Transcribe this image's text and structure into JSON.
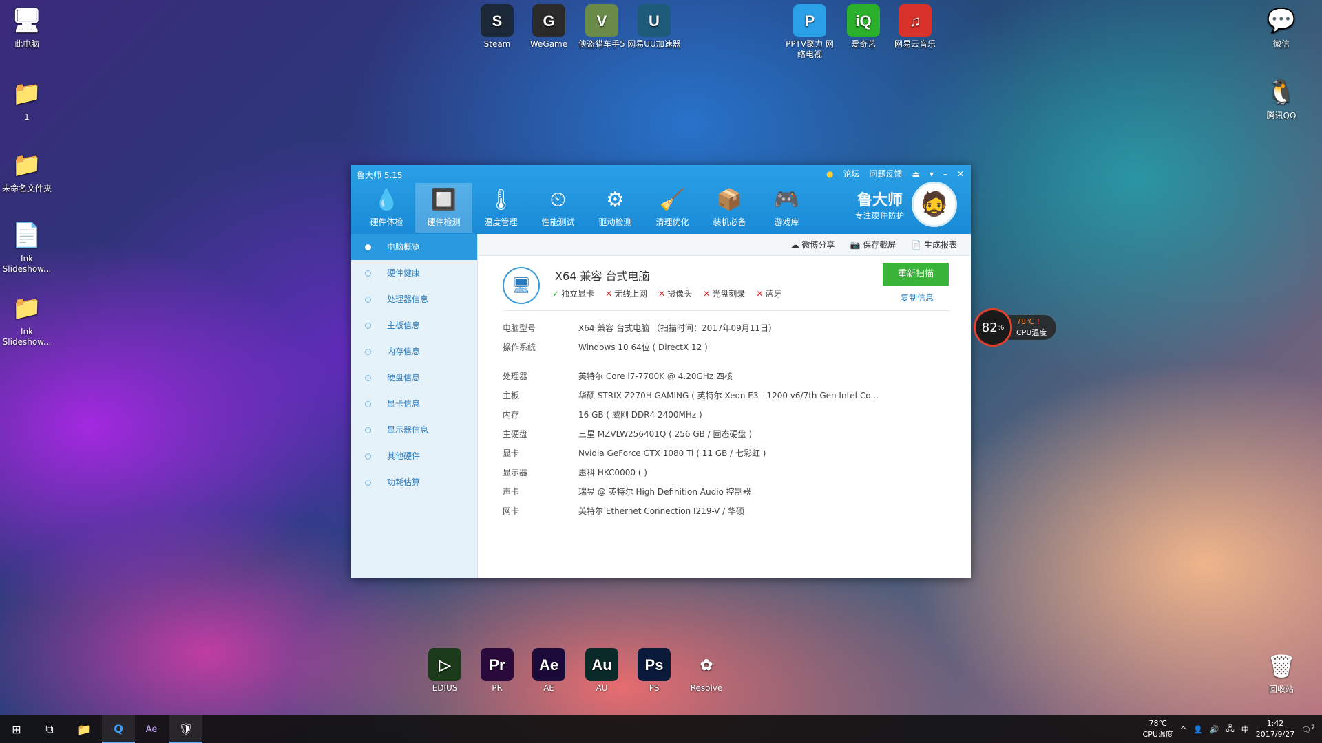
{
  "desktop": {
    "left_icons": [
      {
        "name": "此电脑",
        "glyph": "🖥"
      },
      {
        "name": "1",
        "glyph": "📁"
      },
      {
        "name": "未命名文件夹",
        "glyph": "📁"
      },
      {
        "name": "Ink Slideshow...",
        "glyph": "📄"
      },
      {
        "name": "Ink Slideshow...",
        "glyph": "📁"
      }
    ],
    "top_icons": [
      {
        "name": "Steam",
        "glyph": "S",
        "color": "#1b2838"
      },
      {
        "name": "WeGame",
        "glyph": "G",
        "color": "#2a2a2a"
      },
      {
        "name": "侠盗猎车手5",
        "glyph": "V",
        "color": "#6a8a4a"
      },
      {
        "name": "网易UU加速器",
        "glyph": "U",
        "color": "#1e5a7a"
      },
      {
        "name": "PPTV聚力 网络电视",
        "glyph": "P",
        "color": "#2aa0e6"
      },
      {
        "name": "爱奇艺",
        "glyph": "iQ",
        "color": "#2ab02a"
      },
      {
        "name": "网易云音乐",
        "glyph": "♫",
        "color": "#d8322a"
      }
    ],
    "right_icons": [
      {
        "name": "微信",
        "glyph": "💬"
      },
      {
        "name": "腾讯QQ",
        "glyph": "🐧"
      }
    ],
    "bottom_icons": [
      {
        "name": "EDIUS",
        "glyph": "▷",
        "color": "#1a3a1a"
      },
      {
        "name": "PR",
        "glyph": "Pr",
        "color": "#2a0a3a"
      },
      {
        "name": "AE",
        "glyph": "Ae",
        "color": "#1a0a3a"
      },
      {
        "name": "AU",
        "glyph": "Au",
        "color": "#0a2a2a"
      },
      {
        "name": "PS",
        "glyph": "Ps",
        "color": "#0a1a3a"
      },
      {
        "name": "Resolve",
        "glyph": "✿",
        "color": "transparent"
      }
    ],
    "recycle": {
      "name": "回收站",
      "glyph": "🗑"
    }
  },
  "app": {
    "title": "鲁大师 5.15",
    "controls": [
      "论坛",
      "问题反馈",
      "⏏",
      "▾",
      "–",
      "✕"
    ],
    "tools": [
      {
        "label": "硬件体检",
        "glyph": "💧"
      },
      {
        "label": "硬件检测",
        "glyph": "🔲"
      },
      {
        "label": "温度管理",
        "glyph": "🌡"
      },
      {
        "label": "性能测试",
        "glyph": "⏲"
      },
      {
        "label": "驱动检测",
        "glyph": "⚙"
      },
      {
        "label": "清理优化",
        "glyph": "🧹"
      },
      {
        "label": "装机必备",
        "glyph": "📦"
      },
      {
        "label": "游戏库",
        "glyph": "🎮"
      }
    ],
    "brand_title": "鲁大师",
    "brand_sub": "专注硬件防护",
    "sidebar": [
      "电脑概览",
      "硬件健康",
      "处理器信息",
      "主板信息",
      "内存信息",
      "硬盘信息",
      "显卡信息",
      "显示器信息",
      "其他硬件",
      "功耗估算"
    ],
    "topbar": [
      "微博分享",
      "保存截屏",
      "生成报表"
    ],
    "pc_name": "X64 兼容 台式电脑",
    "features": [
      {
        "ok": true,
        "label": "独立显卡"
      },
      {
        "ok": false,
        "label": "无线上网"
      },
      {
        "ok": false,
        "label": "摄像头"
      },
      {
        "ok": false,
        "label": "光盘刻录"
      },
      {
        "ok": false,
        "label": "蓝牙"
      }
    ],
    "rescan": "重新扫描",
    "copy": "复制信息",
    "info": [
      {
        "k": "电脑型号",
        "v": "X64 兼容 台式电脑 （扫描时间：2017年09月11日）"
      },
      {
        "k": "操作系统",
        "v": "Windows 10 64位 ( DirectX 12 )"
      },
      {
        "k": "处理器",
        "v": "英特尔 Core i7-7700K @ 4.20GHz 四核"
      },
      {
        "k": "主板",
        "v": "华硕 STRIX Z270H GAMING ( 英特尔 Xeon E3 - 1200 v6/7th Gen Intel Co..."
      },
      {
        "k": "内存",
        "v": "16 GB ( 威刚 DDR4 2400MHz )"
      },
      {
        "k": "主硬盘",
        "v": "三星 MZVLW256401Q ( 256 GB / 固态硬盘 )"
      },
      {
        "k": "显卡",
        "v": "Nvidia GeForce GTX 1080 Ti ( 11 GB / 七彩虹 )"
      },
      {
        "k": "显示器",
        "v": "惠科 HKC0000 ( )"
      },
      {
        "k": "声卡",
        "v": "瑞昱 @ 英特尔 High Definition Audio 控制器"
      },
      {
        "k": "网卡",
        "v": "英特尔 Ethernet Connection I219-V / 华硕"
      }
    ]
  },
  "gauge": {
    "percent": "82",
    "unit": "%",
    "temp": "78℃",
    "label": "CPU温度",
    "warn": "!"
  },
  "taskbar": {
    "apps": [
      "⊞",
      "⧉",
      "📁",
      "Q",
      "Ae",
      "🛡"
    ],
    "temp": "78℃",
    "temp_label": "CPU温度",
    "tray": [
      "^",
      "👤",
      "🔊",
      "🖧",
      "中"
    ],
    "time": "1:42",
    "date": "2017/9/27",
    "notif": "2"
  },
  "colors": {
    "accent": "#1a8ad6",
    "rescan": "#3ab53a"
  }
}
